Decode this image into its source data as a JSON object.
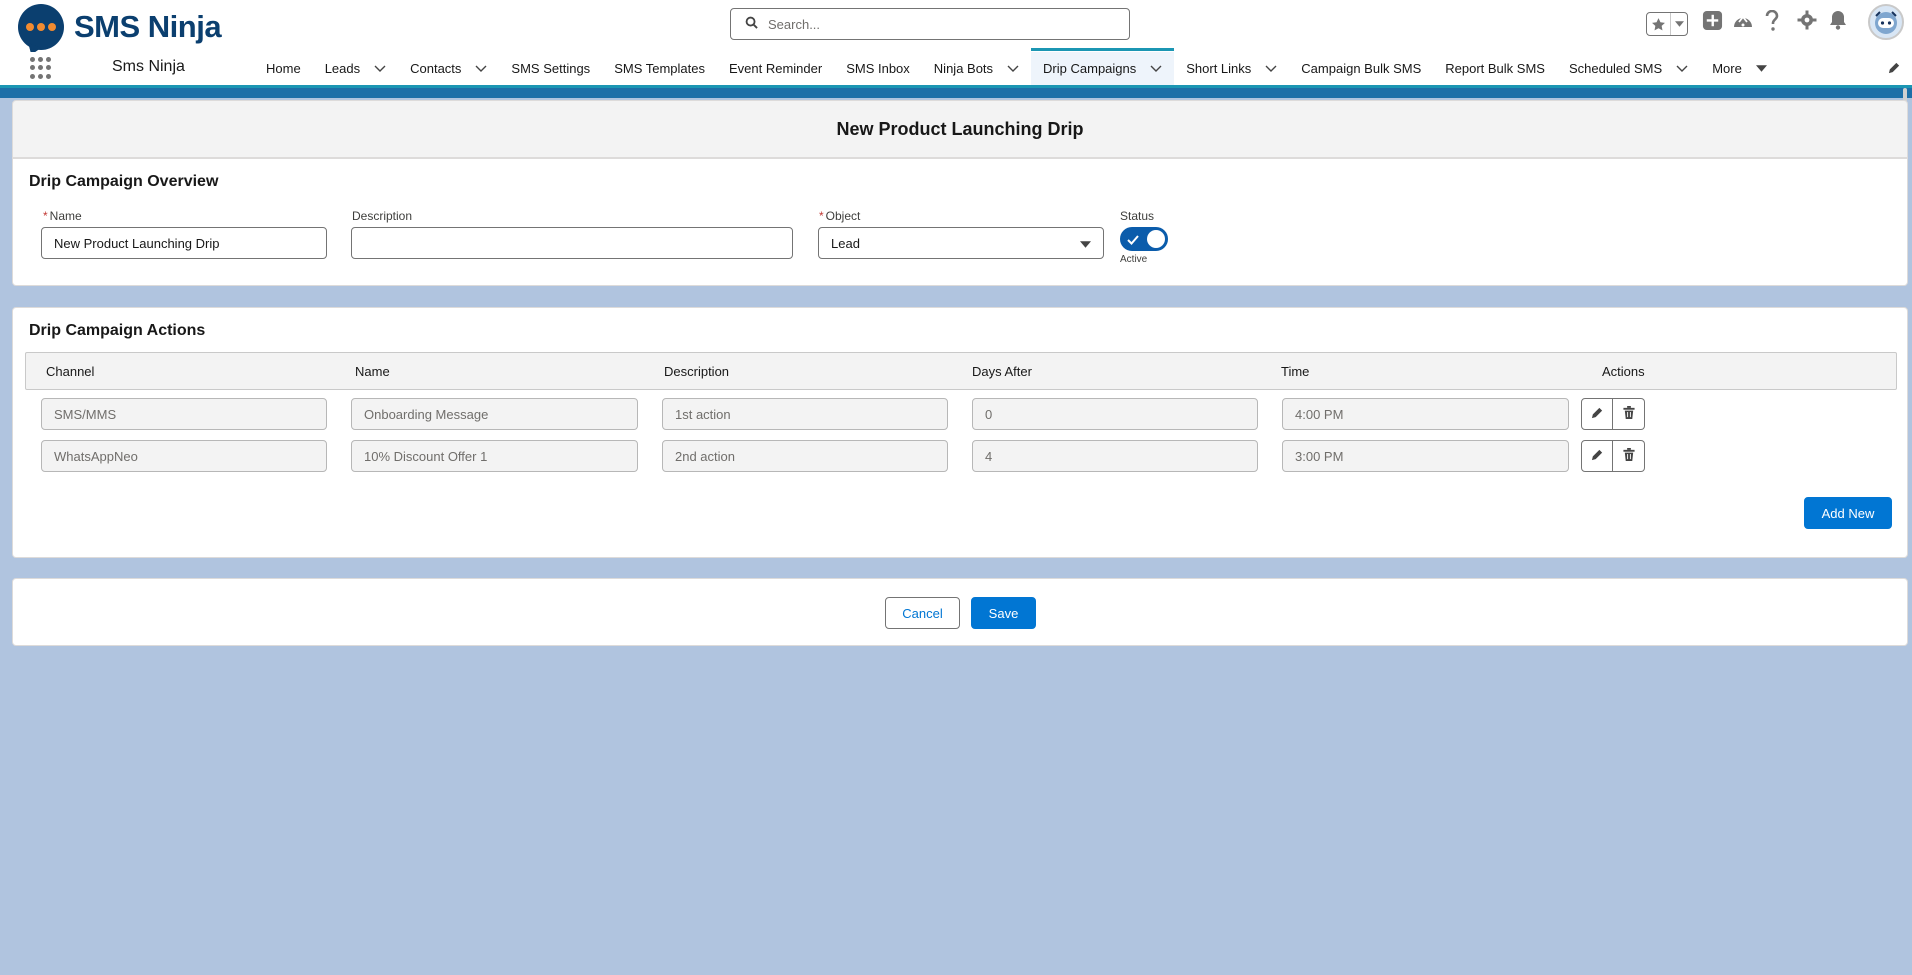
{
  "header": {
    "logo_text": "SMS Ninja",
    "search_placeholder": "Search..."
  },
  "nav": {
    "app_name": "Sms Ninja",
    "items": [
      {
        "label": "Home",
        "dropdown": false
      },
      {
        "label": "Leads",
        "dropdown": true
      },
      {
        "label": "Contacts",
        "dropdown": true
      },
      {
        "label": "SMS Settings",
        "dropdown": false
      },
      {
        "label": "SMS Templates",
        "dropdown": false
      },
      {
        "label": "Event Reminder",
        "dropdown": false
      },
      {
        "label": "SMS Inbox",
        "dropdown": false
      },
      {
        "label": "Ninja Bots",
        "dropdown": true
      },
      {
        "label": "Drip Campaigns",
        "dropdown": true,
        "active": true
      },
      {
        "label": "Short Links",
        "dropdown": true
      },
      {
        "label": "Campaign Bulk SMS",
        "dropdown": false
      },
      {
        "label": "Report Bulk SMS",
        "dropdown": false
      },
      {
        "label": "Scheduled SMS",
        "dropdown": true
      },
      {
        "label": "More",
        "dropdown": true
      }
    ]
  },
  "page": {
    "title": "New Product Launching Drip"
  },
  "overview": {
    "title": "Drip Campaign Overview",
    "name_label": "Name",
    "name_value": "New Product Launching Drip",
    "description_label": "Description",
    "description_value": "",
    "object_label": "Object",
    "object_value": "Lead",
    "status_label": "Status",
    "status_value": "Active",
    "status_on": true
  },
  "actions": {
    "title": "Drip Campaign Actions",
    "columns": [
      "Channel",
      "Name",
      "Description",
      "Days After",
      "Time",
      "Actions"
    ],
    "rows": [
      {
        "channel": "SMS/MMS",
        "name": "Onboarding Message",
        "description": "1st action",
        "days_after": "0",
        "time": "4:00 PM"
      },
      {
        "channel": "WhatsAppNeo",
        "name": "10% Discount Offer 1",
        "description": "2nd action",
        "days_after": "4",
        "time": "3:00 PM"
      }
    ],
    "add_new_label": "Add New"
  },
  "footer": {
    "cancel_label": "Cancel",
    "save_label": "Save"
  },
  "colors": {
    "brand": "#0176d3",
    "nav_accent": "#1b96b3",
    "toggle_on": "#0b5cab",
    "page_bg": "#b0c4df"
  }
}
